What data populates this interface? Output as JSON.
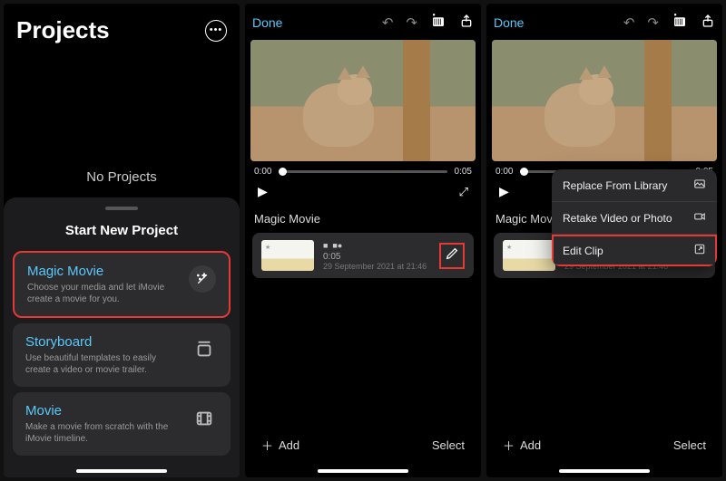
{
  "screen1": {
    "title": "Projects",
    "empty": "No Projects",
    "sheetTitle": "Start New Project",
    "options": [
      {
        "title": "Magic Movie",
        "desc": "Choose your media and let iMovie create a movie for you."
      },
      {
        "title": "Storyboard",
        "desc": "Use beautiful templates to easily create a video or movie trailer."
      },
      {
        "title": "Movie",
        "desc": "Make a movie from scratch with the iMovie timeline."
      }
    ]
  },
  "editor": {
    "done": "Done",
    "timeStart": "0:00",
    "timeEnd": "0:05",
    "section": "Magic Movie",
    "clip": {
      "duration": "0:05",
      "date": "29 September 2021 at 21:46"
    },
    "add": "Add",
    "select": "Select"
  },
  "popup": {
    "items": [
      {
        "label": "Replace From Library",
        "icon": "image"
      },
      {
        "label": "Retake Video or Photo",
        "icon": "camera"
      },
      {
        "label": "Edit Clip",
        "icon": "open"
      }
    ]
  }
}
